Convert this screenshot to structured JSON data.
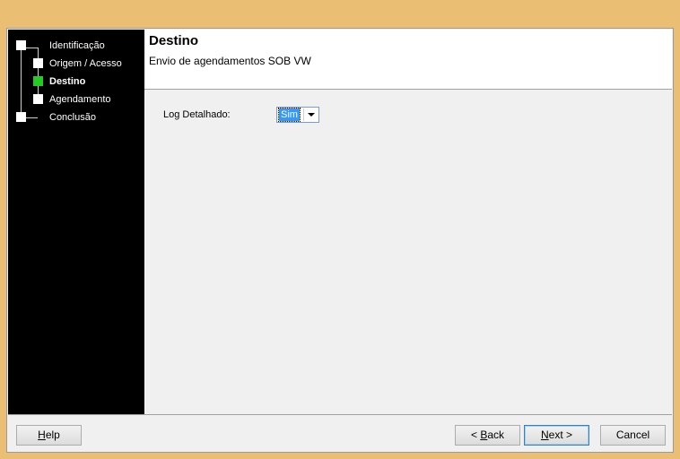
{
  "wizard": {
    "steps": [
      {
        "label": "Identificação",
        "state": "done"
      },
      {
        "label": "Origem / Acesso",
        "state": "done"
      },
      {
        "label": "Destino",
        "state": "active"
      },
      {
        "label": "Agendamento",
        "state": "pending"
      },
      {
        "label": "Conclusão",
        "state": "pending"
      }
    ],
    "active_color": "#22cc22"
  },
  "header": {
    "title": "Destino",
    "subtitle": "Envio de agendamentos SOB VW"
  },
  "form": {
    "log_label": "Log Detalhado:",
    "log_value": "Sim"
  },
  "buttons": {
    "help_mnemonic": "H",
    "help_rest": "elp",
    "back_prefix": "< ",
    "back_mnemonic": "B",
    "back_rest": "ack",
    "next_mnemonic": "N",
    "next_rest": "ext >",
    "cancel": "Cancel"
  }
}
